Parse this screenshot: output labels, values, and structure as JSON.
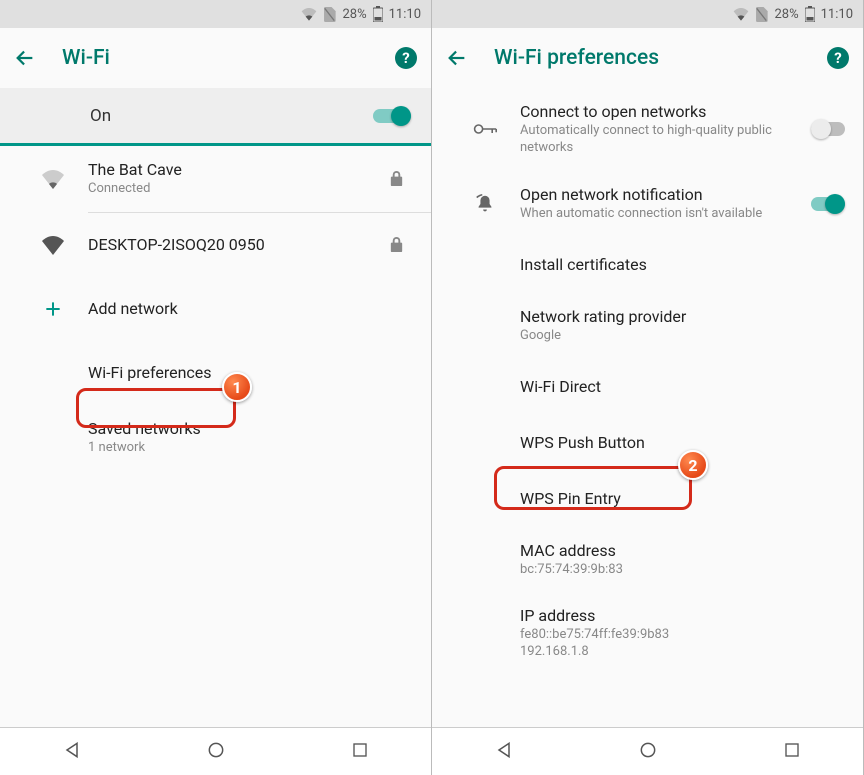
{
  "status": {
    "battery": "28%",
    "time": "11:10"
  },
  "left": {
    "title": "Wi-Fi",
    "toggleLabel": "On",
    "networks": [
      {
        "ssid": "The Bat Cave",
        "status": "Connected",
        "locked": true,
        "signal": "weak"
      },
      {
        "ssid": "DESKTOP-2ISOQ20 0950",
        "status": "",
        "locked": true,
        "signal": "strong"
      }
    ],
    "addNetwork": "Add network",
    "prefs": "Wi-Fi preferences",
    "saved": {
      "label": "Saved networks",
      "sub": "1 network"
    }
  },
  "right": {
    "title": "Wi-Fi preferences",
    "items": {
      "openNet": {
        "t": "Connect to open networks",
        "s": "Automatically connect to high-quality public networks"
      },
      "notif": {
        "t": "Open network notification",
        "s": "When automatic connection isn't available"
      },
      "cert": {
        "t": "Install certificates"
      },
      "rating": {
        "t": "Network rating provider",
        "s": "Google"
      },
      "direct": {
        "t": "Wi-Fi Direct"
      },
      "wpsPush": {
        "t": "WPS Push Button"
      },
      "wpsPin": {
        "t": "WPS Pin Entry"
      },
      "mac": {
        "t": "MAC address",
        "s": "bc:75:74:39:9b:83"
      },
      "ip": {
        "t": "IP address",
        "s": "fe80::be75:74ff:fe39:9b83\n192.168.1.8"
      }
    }
  },
  "callouts": {
    "one": "1",
    "two": "2"
  }
}
